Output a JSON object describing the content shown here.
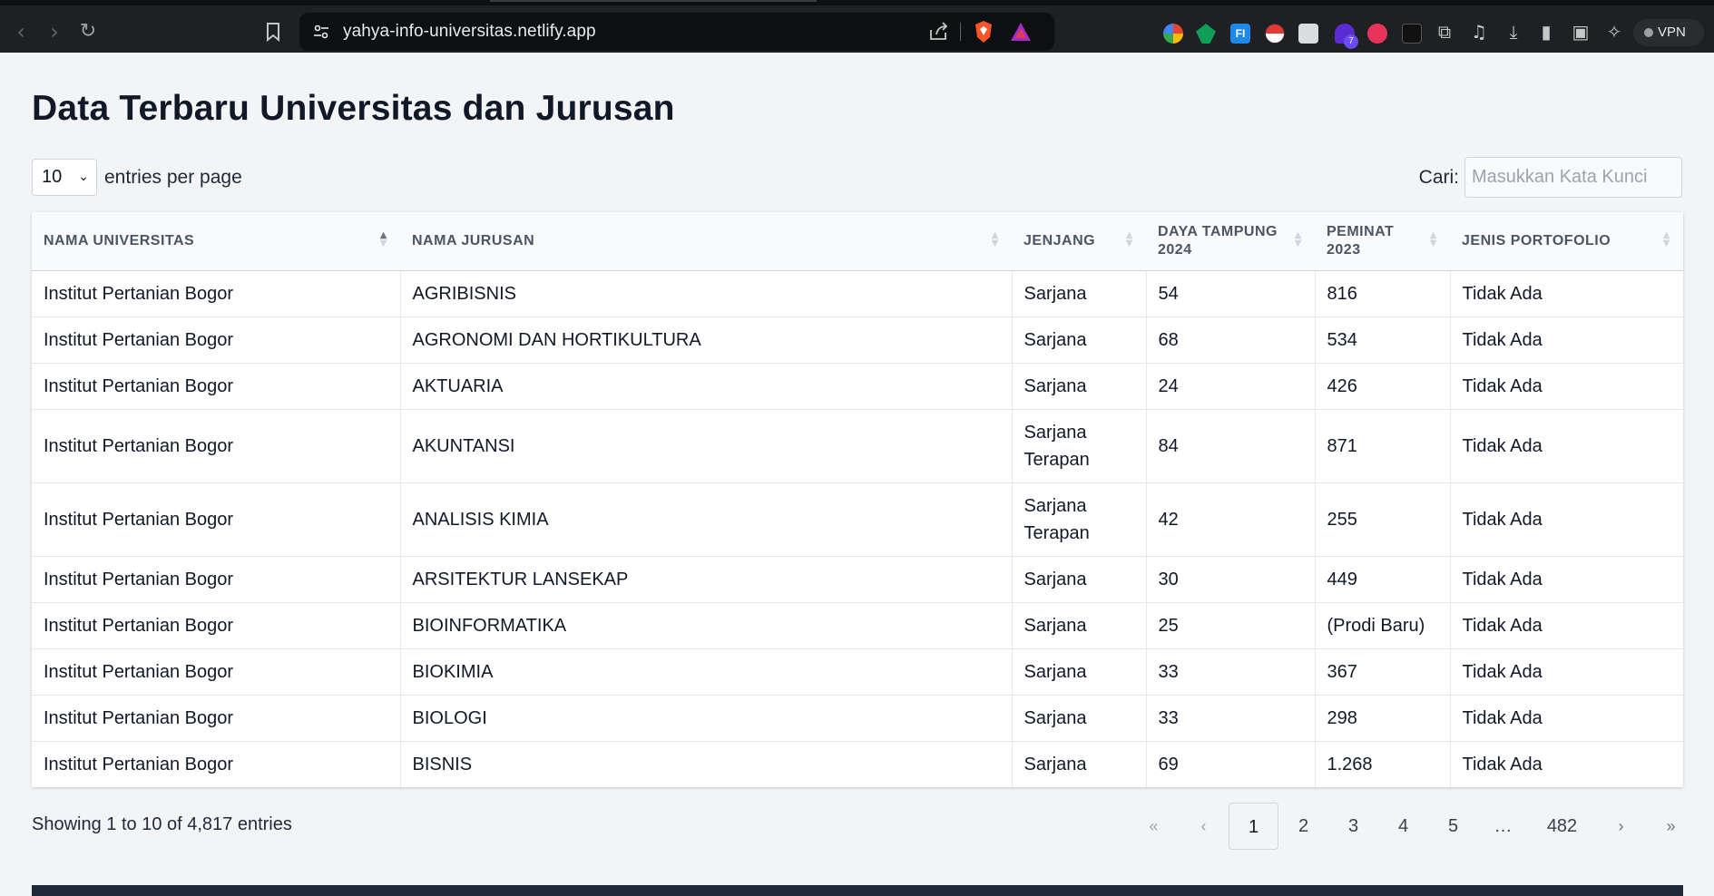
{
  "browser": {
    "url": "yahya-info-universitas.netlify.app",
    "vpn_label": "VPN",
    "ext_badge": "7"
  },
  "page": {
    "title": "Data Terbaru Universitas dan Jurusan",
    "length_value": "10",
    "length_label": "entries per page",
    "search_label": "Cari:",
    "search_placeholder": "Masukkan Kata Kunci",
    "search_value": ""
  },
  "table": {
    "headers": [
      {
        "label": "NAMA UNIVERSITAS",
        "sort": "asc"
      },
      {
        "label": "NAMA JURUSAN",
        "sort": "none"
      },
      {
        "label": "JENJANG",
        "sort": "none"
      },
      {
        "label": "DAYA TAMPUNG 2024",
        "sort": "none"
      },
      {
        "label": "PEMINAT 2023",
        "sort": "none"
      },
      {
        "label": "JENIS PORTOFOLIO",
        "sort": "none"
      }
    ],
    "rows": [
      [
        "Institut Pertanian Bogor",
        "AGRIBISNIS",
        "Sarjana",
        "54",
        "816",
        "Tidak Ada"
      ],
      [
        "Institut Pertanian Bogor",
        "AGRONOMI DAN HORTIKULTURA",
        "Sarjana",
        "68",
        "534",
        "Tidak Ada"
      ],
      [
        "Institut Pertanian Bogor",
        "AKTUARIA",
        "Sarjana",
        "24",
        "426",
        "Tidak Ada"
      ],
      [
        "Institut Pertanian Bogor",
        "AKUNTANSI",
        "Sarjana Terapan",
        "84",
        "871",
        "Tidak Ada"
      ],
      [
        "Institut Pertanian Bogor",
        "ANALISIS KIMIA",
        "Sarjana Terapan",
        "42",
        "255",
        "Tidak Ada"
      ],
      [
        "Institut Pertanian Bogor",
        "ARSITEKTUR LANSEKAP",
        "Sarjana",
        "30",
        "449",
        "Tidak Ada"
      ],
      [
        "Institut Pertanian Bogor",
        "BIOINFORMATIKA",
        "Sarjana",
        "25",
        "(Prodi Baru)",
        "Tidak Ada"
      ],
      [
        "Institut Pertanian Bogor",
        "BIOKIMIA",
        "Sarjana",
        "33",
        "367",
        "Tidak Ada"
      ],
      [
        "Institut Pertanian Bogor",
        "BIOLOGI",
        "Sarjana",
        "33",
        "298",
        "Tidak Ada"
      ],
      [
        "Institut Pertanian Bogor",
        "BISNIS",
        "Sarjana",
        "69",
        "1.268",
        "Tidak Ada"
      ]
    ]
  },
  "footer": {
    "info": "Showing 1 to 10 of 4,817 entries",
    "pagination": {
      "first": "«",
      "prev": "‹",
      "pages": [
        "1",
        "2",
        "3",
        "4",
        "5"
      ],
      "ellipsis": "…",
      "last_page": "482",
      "next": "›",
      "last": "»",
      "current": "1"
    }
  },
  "colors": {
    "page_bg": "#f3f4f6",
    "chrome_bg": "#1f2023",
    "title_color": "#111827",
    "header_text": "#4b5563"
  }
}
